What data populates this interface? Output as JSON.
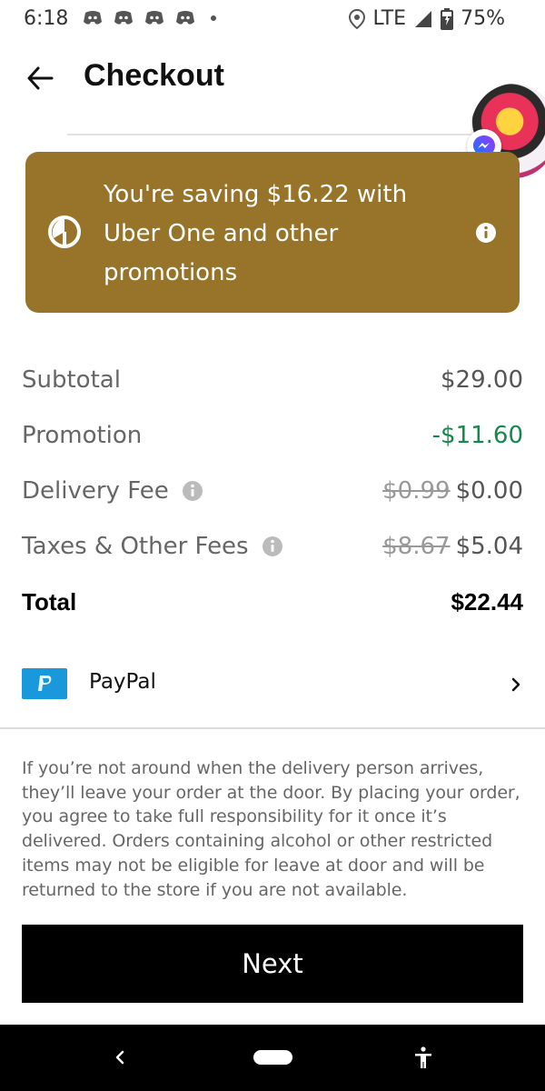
{
  "status_bar": {
    "time": "6:18",
    "network": "LTE",
    "battery": "75%",
    "notification_icons": [
      "discord-icon",
      "discord-icon",
      "discord-icon",
      "discord-icon"
    ]
  },
  "header": {
    "title": "Checkout"
  },
  "promo": {
    "text": "You're saving $16.22 with Uber One and other promotions",
    "background": "#97742a"
  },
  "fees": {
    "subtotal": {
      "label": "Subtotal",
      "value": "$29.00"
    },
    "promotion": {
      "label": "Promotion",
      "value": "-$11.60"
    },
    "delivery": {
      "label": "Delivery Fee",
      "original": "$0.99",
      "value": "$0.00"
    },
    "taxes": {
      "label": "Taxes & Other Fees",
      "original": "$8.67",
      "value": "$5.04"
    },
    "total": {
      "label": "Total",
      "value": "$22.44"
    }
  },
  "payment": {
    "method": "PayPal"
  },
  "disclaimer": "If you’re not around when the delivery person arrives, they’ll leave your order at the door. By placing your order, you agree to take full responsibility for it once it’s delivered. Orders containing alcohol or other restricted items may not be eligible for leave at door and will be returned to the store if you are not available.",
  "next_button": {
    "label": "Next"
  },
  "colors": {
    "promo_green": "#138a4a",
    "promo_banner": "#97742a",
    "paypal_blue": "#1a98dc"
  }
}
